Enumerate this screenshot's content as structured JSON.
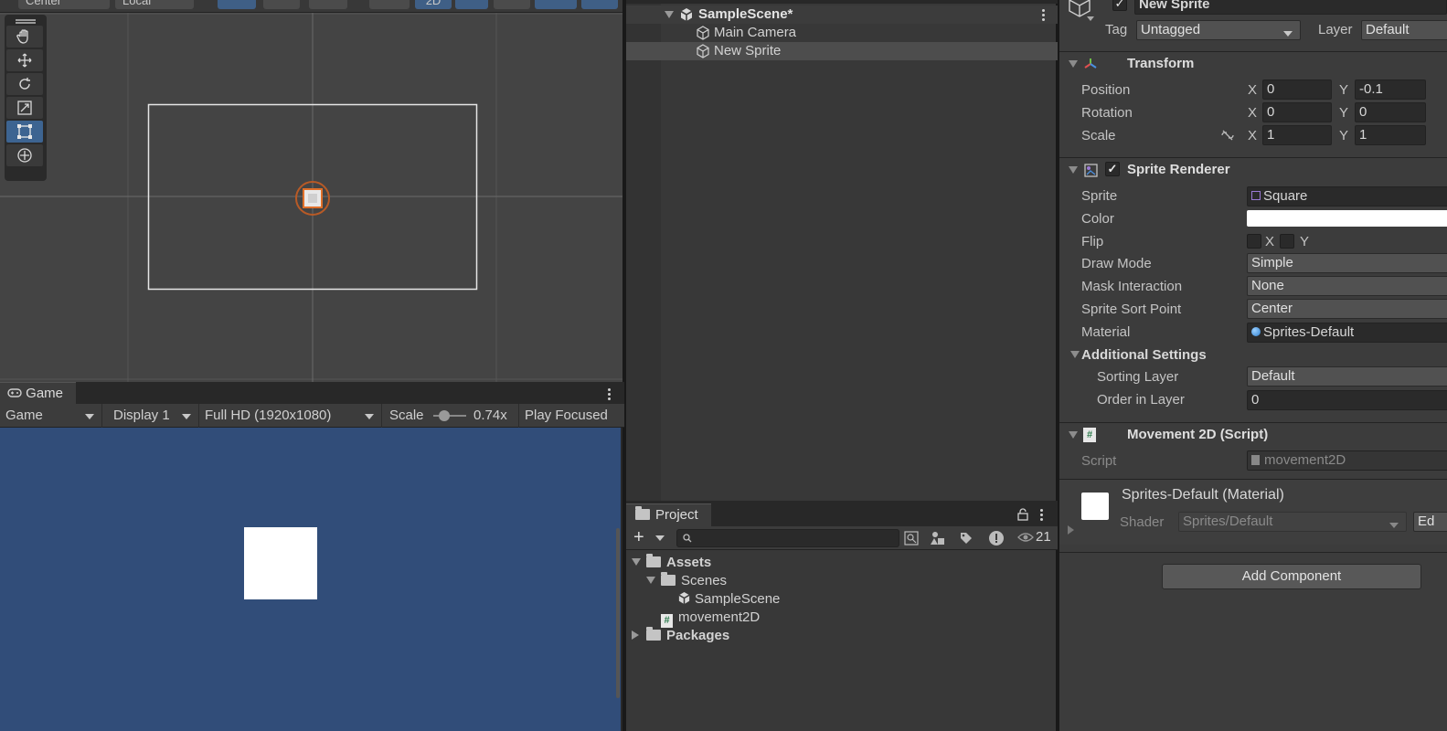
{
  "scene_view": {
    "toolbar": {
      "pivot": "Center",
      "space": "Local",
      "mode_2d": "2D"
    },
    "tools": [
      "view-tool",
      "move-tool",
      "rotate-tool",
      "scale-tool",
      "rect-tool",
      "transform-tool"
    ],
    "active_tool_index": 4
  },
  "game_view": {
    "tab_label": "Game",
    "mode_dropdown": "Game",
    "display_dropdown": "Display 1",
    "resolution_dropdown": "Full HD (1920x1080)",
    "scale_label": "Scale",
    "scale_value": "0.74x",
    "play_mode": "Play Focused",
    "background_color": "#314d79"
  },
  "hierarchy": {
    "scene_name": "SampleScene*",
    "items": [
      {
        "label": "Main Camera",
        "selected": false
      },
      {
        "label": "New Sprite",
        "selected": true
      }
    ]
  },
  "project": {
    "tab_label": "Project",
    "search_placeholder": "",
    "hidden_count": "21",
    "tree": {
      "assets": "Assets",
      "scenes": "Scenes",
      "sample_scene": "SampleScene",
      "script": "movement2D",
      "packages": "Packages"
    }
  },
  "inspector": {
    "object_name": "New Sprite",
    "tag_label": "Tag",
    "tag_value": "Untagged",
    "layer_label": "Layer",
    "layer_value": "Default",
    "transform": {
      "title": "Transform",
      "position_label": "Position",
      "rotation_label": "Rotation",
      "scale_label": "Scale",
      "position": {
        "x": "0",
        "y": "-0.1"
      },
      "rotation": {
        "x": "0",
        "y": "0"
      },
      "scale": {
        "x": "1",
        "y": "1"
      },
      "x_axis": "X",
      "y_axis": "Y"
    },
    "sprite_renderer": {
      "title": "Sprite Renderer",
      "sprite_label": "Sprite",
      "sprite_value": "Square",
      "color_label": "Color",
      "color_value": "#ffffff",
      "flip_label": "Flip",
      "flip_x": "X",
      "flip_y": "Y",
      "draw_mode_label": "Draw Mode",
      "draw_mode_value": "Simple",
      "mask_label": "Mask Interaction",
      "mask_value": "None",
      "sort_point_label": "Sprite Sort Point",
      "sort_point_value": "Center",
      "material_label": "Material",
      "material_value": "Sprites-Default",
      "additional_label": "Additional Settings",
      "sorting_layer_label": "Sorting Layer",
      "sorting_layer_value": "Default",
      "order_label": "Order in Layer",
      "order_value": "0"
    },
    "script_component": {
      "title": "Movement 2D (Script)",
      "script_label": "Script",
      "script_value": "movement2D"
    },
    "material": {
      "title": "Sprites-Default (Material)",
      "shader_label": "Shader",
      "shader_value": "Sprites/Default",
      "edit_label": "Ed"
    },
    "add_component": "Add Component"
  }
}
